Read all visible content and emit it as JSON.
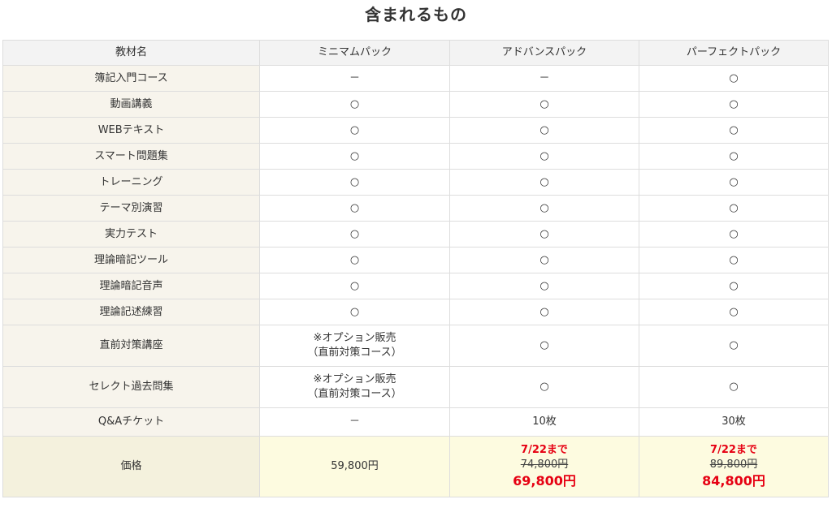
{
  "heading": "含まれるもの",
  "columns": [
    "教材名",
    "ミニマムパック",
    "アドバンスパック",
    "パーフェクトパック"
  ],
  "rows": [
    {
      "name": "簿記入門コース",
      "minimum": "－",
      "advance": "－",
      "perfect": "○"
    },
    {
      "name": "動画講義",
      "minimum": "○",
      "advance": "○",
      "perfect": "○"
    },
    {
      "name": "WEBテキスト",
      "minimum": "○",
      "advance": "○",
      "perfect": "○"
    },
    {
      "name": "スマート問題集",
      "minimum": "○",
      "advance": "○",
      "perfect": "○"
    },
    {
      "name": "トレーニング",
      "minimum": "○",
      "advance": "○",
      "perfect": "○"
    },
    {
      "name": "テーマ別演習",
      "minimum": "○",
      "advance": "○",
      "perfect": "○"
    },
    {
      "name": "実力テスト",
      "minimum": "○",
      "advance": "○",
      "perfect": "○"
    },
    {
      "name": "理論暗記ツール",
      "minimum": "○",
      "advance": "○",
      "perfect": "○"
    },
    {
      "name": "理論暗記音声",
      "minimum": "○",
      "advance": "○",
      "perfect": "○"
    },
    {
      "name": "理論記述練習",
      "minimum": "○",
      "advance": "○",
      "perfect": "○"
    },
    {
      "name": "直前対策講座",
      "minimum_line1": "※オプション販売",
      "minimum_line2": "（直前対策コース）",
      "advance": "○",
      "perfect": "○"
    },
    {
      "name": "セレクト過去問集",
      "minimum_line1": "※オプション販売",
      "minimum_line2": "（直前対策コース）",
      "advance": "○",
      "perfect": "○"
    },
    {
      "name": "Q&Aチケット",
      "minimum": "－",
      "advance": "10枚",
      "perfect": "30枚"
    }
  ],
  "price": {
    "label": "価格",
    "minimum": "59,800円",
    "advance": {
      "deadline": "7/22まで",
      "old": "74,800円",
      "new": "69,800円"
    },
    "perfect": {
      "deadline": "7/22まで",
      "old": "89,800円",
      "new": "84,800円"
    }
  },
  "colors": {
    "sale_red": "#e60012",
    "label_bg": "#f7f4ec",
    "price_bg": "#fdfbe0",
    "header_bg": "#f3f3f3"
  }
}
